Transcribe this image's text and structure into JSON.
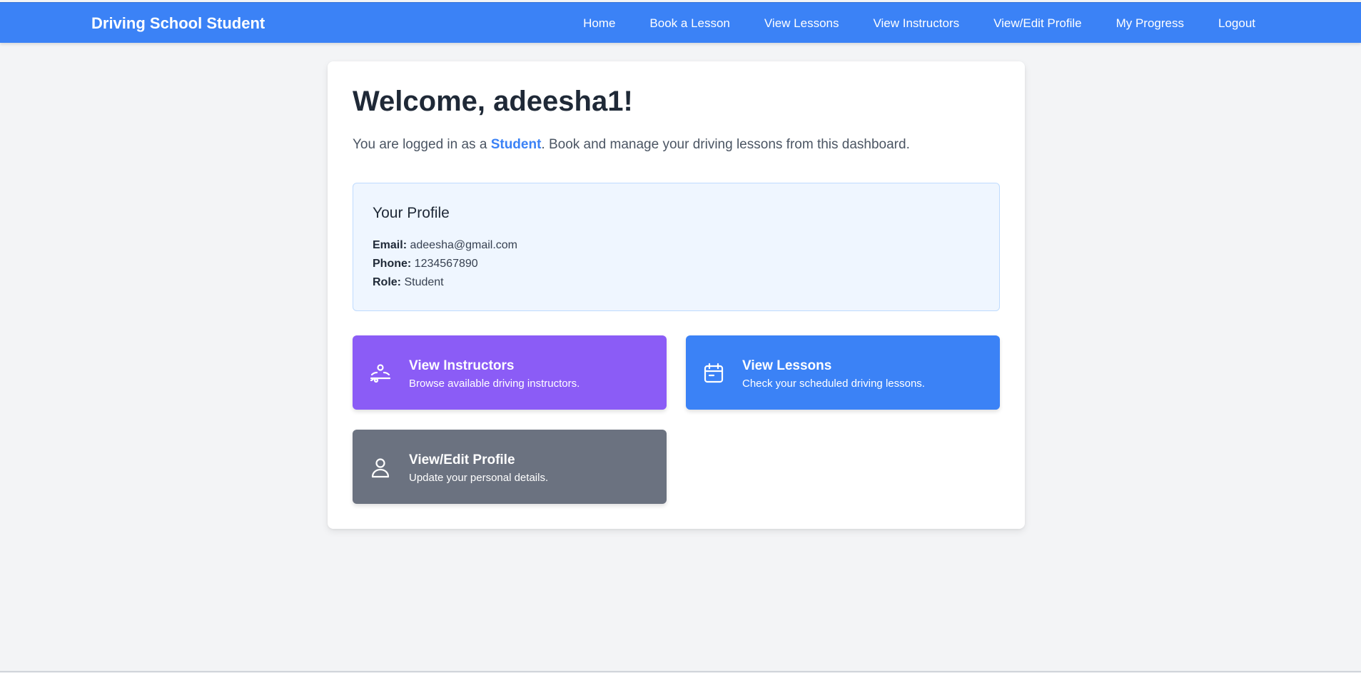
{
  "header": {
    "brand": "Driving School Student",
    "nav": [
      "Home",
      "Book a Lesson",
      "View Lessons",
      "View Instructors",
      "View/Edit Profile",
      "My Progress",
      "Logout"
    ]
  },
  "main": {
    "welcome": "Welcome, adeesha1!",
    "intro_prefix": "You are logged in as a ",
    "intro_role": "Student",
    "intro_suffix": ". Book and manage your driving lessons from this dashboard."
  },
  "profile": {
    "title": "Your Profile",
    "email_label": "Email:",
    "email": "adeesha@gmail.com",
    "phone_label": "Phone:",
    "phone": "1234567890",
    "role_label": "Role:",
    "role": "Student"
  },
  "actions": [
    {
      "title": "View Instructors",
      "desc": "Browse available driving instructors.",
      "icon": "instructor-icon",
      "color": "#8b5cf6"
    },
    {
      "title": "View Lessons",
      "desc": "Check your scheduled driving lessons.",
      "icon": "calendar-icon",
      "color": "#3b82f6"
    },
    {
      "title": "View/Edit Profile",
      "desc": "Update your personal details.",
      "icon": "user-icon",
      "color": "#6b7280"
    }
  ],
  "colors": {
    "primary": "#3b82f6",
    "purple": "#8b5cf6",
    "gray": "#6b7280",
    "background": "#f3f4f6"
  }
}
